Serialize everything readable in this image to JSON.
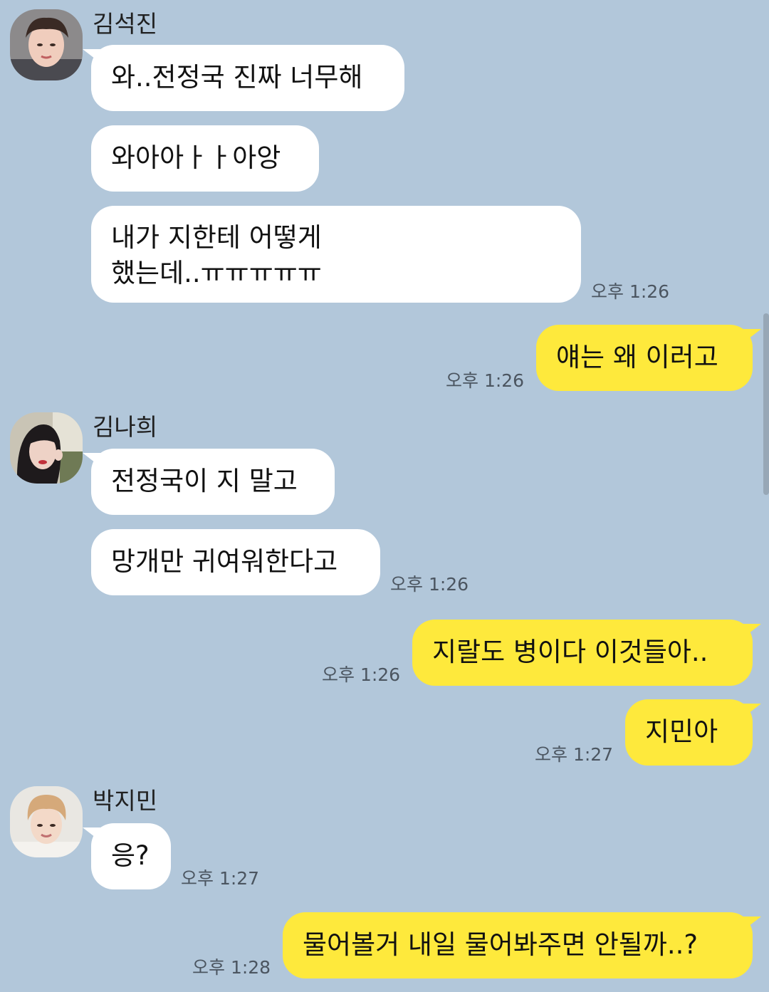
{
  "messages": [
    {
      "sender": "김석진",
      "side": "in",
      "bubbles": [
        "와..전정국 진짜 너무해",
        "와아아ㅏㅏ아앙",
        "내가 지한테 어떻게\n했는데..ㅠㅠㅠㅠㅠ"
      ],
      "time": "오후 1:26"
    },
    {
      "side": "out",
      "bubbles": [
        "얘는 왜 이러고"
      ],
      "time": "오후 1:26"
    },
    {
      "sender": "김나희",
      "side": "in",
      "bubbles": [
        "전정국이 지 말고",
        "망개만 귀여워한다고"
      ],
      "time": "오후 1:26"
    },
    {
      "side": "out",
      "bubbles": [
        "지랄도 병이다 이것들아.."
      ],
      "time": "오후 1:26"
    },
    {
      "side": "out",
      "bubbles": [
        "지민아"
      ],
      "time": "오후 1:27"
    },
    {
      "sender": "박지민",
      "side": "in",
      "bubbles": [
        "응?"
      ],
      "time": "오후 1:27"
    },
    {
      "side": "out",
      "bubbles": [
        "물어볼거 내일 물어봐주면 안될까..?"
      ],
      "time": "오후 1:28"
    }
  ],
  "colors": {
    "background": "#b2c7da",
    "incoming_bubble": "#ffffff",
    "outgoing_bubble": "#fee93c"
  }
}
